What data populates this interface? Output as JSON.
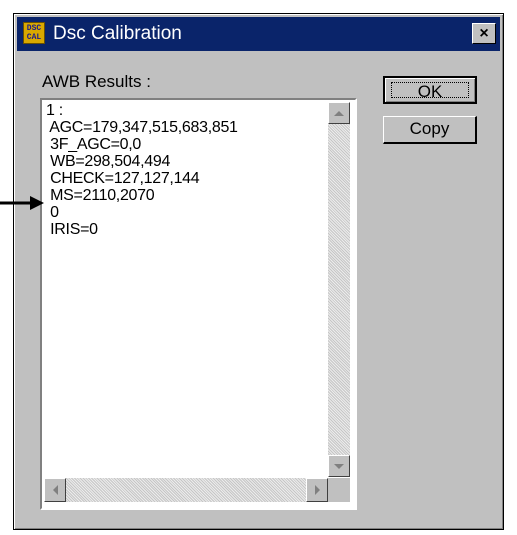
{
  "window": {
    "title": "Dsc Calibration",
    "icon_text": "DSC\nCAL",
    "close_glyph": "×"
  },
  "main": {
    "label": "AWB Results :",
    "results_text": "1 :\n AGC=179,347,515,683,851\n 3F_AGC=0,0\n WB=298,504,494\n CHECK=127,127,144\n MS=2110,2070\n 0\n IRIS=0"
  },
  "buttons": {
    "ok": "OK",
    "copy": "Copy"
  },
  "colors": {
    "titlebar": "#0a246a",
    "face": "#c0c0c0"
  }
}
